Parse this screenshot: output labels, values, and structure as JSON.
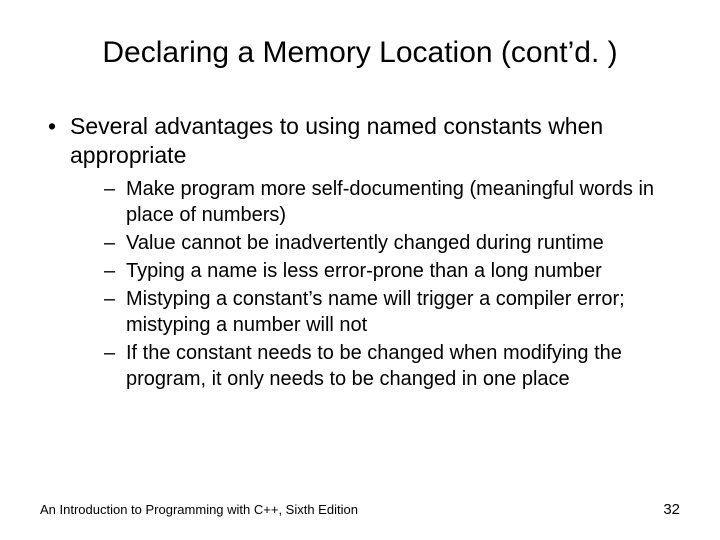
{
  "title": "Declaring a Memory Location (cont’d. )",
  "bullets": [
    {
      "text": "Several advantages to using named constants when appropriate",
      "sub": [
        "Make program more self-documenting (meaningful words in place of numbers)",
        "Value cannot be inadvertently changed during runtime",
        "Typing a name is less error-prone than a long number",
        "Mistyping a constant’s name will trigger a compiler error; mistyping a number will not",
        "If the constant needs to be changed when modifying the program, it only needs to be changed in one place"
      ]
    }
  ],
  "footer": {
    "text": "An Introduction to Programming with C++, Sixth Edition",
    "page": "32"
  }
}
